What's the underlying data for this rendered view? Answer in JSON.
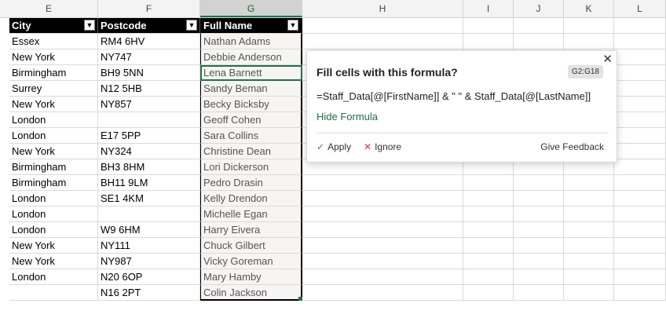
{
  "columns": [
    "E",
    "F",
    "G",
    "H",
    "I",
    "J",
    "K",
    "L"
  ],
  "selected_column": "G",
  "table_headers": {
    "city": "City",
    "postcode": "Postcode",
    "fullname": "Full Name"
  },
  "rows": [
    {
      "city": "Essex",
      "postcode": "RM4 6HV",
      "name": "Nathan Adams"
    },
    {
      "city": "New York",
      "postcode": "NY747",
      "name": "Debbie Anderson"
    },
    {
      "city": "Birmingham",
      "postcode": "BH9 5NN",
      "name": "Lena Barnett"
    },
    {
      "city": "Surrey",
      "postcode": "N12 5HB",
      "name": "Sandy Beman"
    },
    {
      "city": "New York",
      "postcode": "NY857",
      "name": "Becky Bicksby"
    },
    {
      "city": "London",
      "postcode": "",
      "name": "Geoff Cohen"
    },
    {
      "city": "London",
      "postcode": "E17 5PP",
      "name": "Sara Collins"
    },
    {
      "city": "New York",
      "postcode": "NY324",
      "name": "Christine Dean"
    },
    {
      "city": "Birmingham",
      "postcode": "BH3 8HM",
      "name": "Lori Dickerson"
    },
    {
      "city": "Birmingham",
      "postcode": "BH11 9LM",
      "name": "Pedro Drasin"
    },
    {
      "city": "London",
      "postcode": "SE1 4KM",
      "name": "Kelly Drendon"
    },
    {
      "city": "London",
      "postcode": "",
      "name": "Michelle Egan"
    },
    {
      "city": "London",
      "postcode": "W9 6HM",
      "name": "Harry Eivera"
    },
    {
      "city": "New York",
      "postcode": "NY111",
      "name": "Chuck Gilbert"
    },
    {
      "city": "New York",
      "postcode": "NY987",
      "name": "Vicky Goreman"
    },
    {
      "city": "London",
      "postcode": "N20 6OP",
      "name": "Mary Hamby"
    },
    {
      "city": "",
      "postcode": "N16 2PT",
      "name": "Colin Jackson"
    }
  ],
  "active_row_index": 2,
  "popup": {
    "title": "Fill cells with this formula?",
    "range": "G2:G18",
    "close_glyph": "✕",
    "formula": "=Staff_Data[@[FirstName]] & \" \" & Staff_Data[@[LastName]]",
    "hide_label": "Hide Formula",
    "apply_label": "Apply",
    "ignore_label": "Ignore",
    "feedback_label": "Give Feedback",
    "accent_color": "#1e6e45"
  }
}
